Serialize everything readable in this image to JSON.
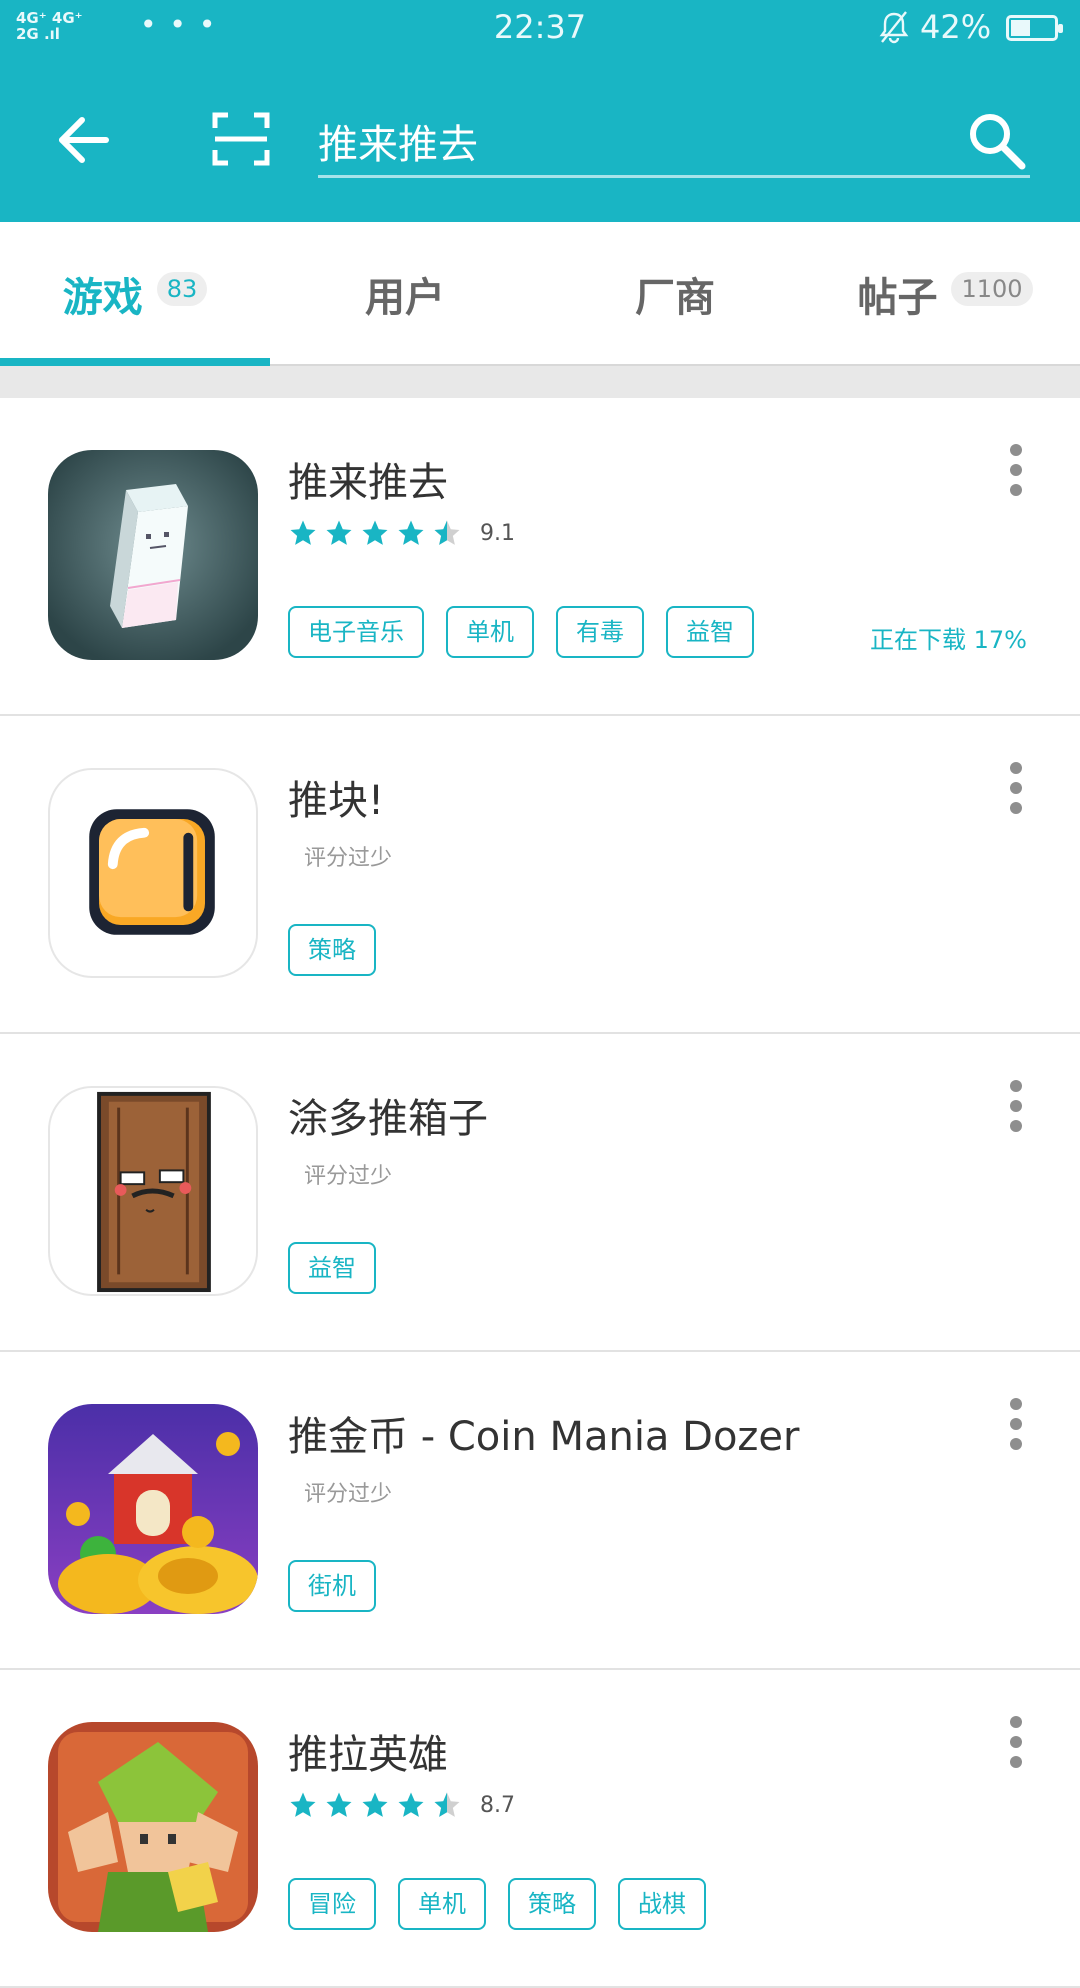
{
  "status_bar": {
    "signal": "4G⁺ 4G⁺",
    "signal_2": "2G .ıl",
    "more": "• • •",
    "time": "22:37",
    "battery": "42%",
    "battery_level": 0.42
  },
  "search": {
    "query": "推来推去"
  },
  "tabs": [
    {
      "label": "游戏",
      "count": "83",
      "active": true
    },
    {
      "label": "用户",
      "count": "",
      "active": false
    },
    {
      "label": "厂商",
      "count": "",
      "active": false
    },
    {
      "label": "帖子",
      "count": "1100",
      "active": false
    }
  ],
  "results": [
    {
      "name": "推来推去",
      "rating": "9.1",
      "stars": 4.5,
      "tags": [
        "电子音乐",
        "单机",
        "有毒",
        "益智"
      ],
      "status": "正在下载 17%"
    },
    {
      "name": "推块!",
      "rating_text": "评分过少",
      "tags": [
        "策略"
      ]
    },
    {
      "name": "涂多推箱子",
      "rating_text": "评分过少",
      "tags": [
        "益智"
      ]
    },
    {
      "name": "推金币 - Coin Mania Dozer",
      "rating_text": "评分过少",
      "tags": [
        "街机"
      ]
    },
    {
      "name": "推拉英雄",
      "rating": "8.7",
      "stars": 4.5,
      "tags": [
        "冒险",
        "单机",
        "策略",
        "战棋"
      ]
    }
  ],
  "colors": {
    "accent": "#19b5c4",
    "star": "#19b5c4",
    "star_empty": "#d0d0d0"
  }
}
